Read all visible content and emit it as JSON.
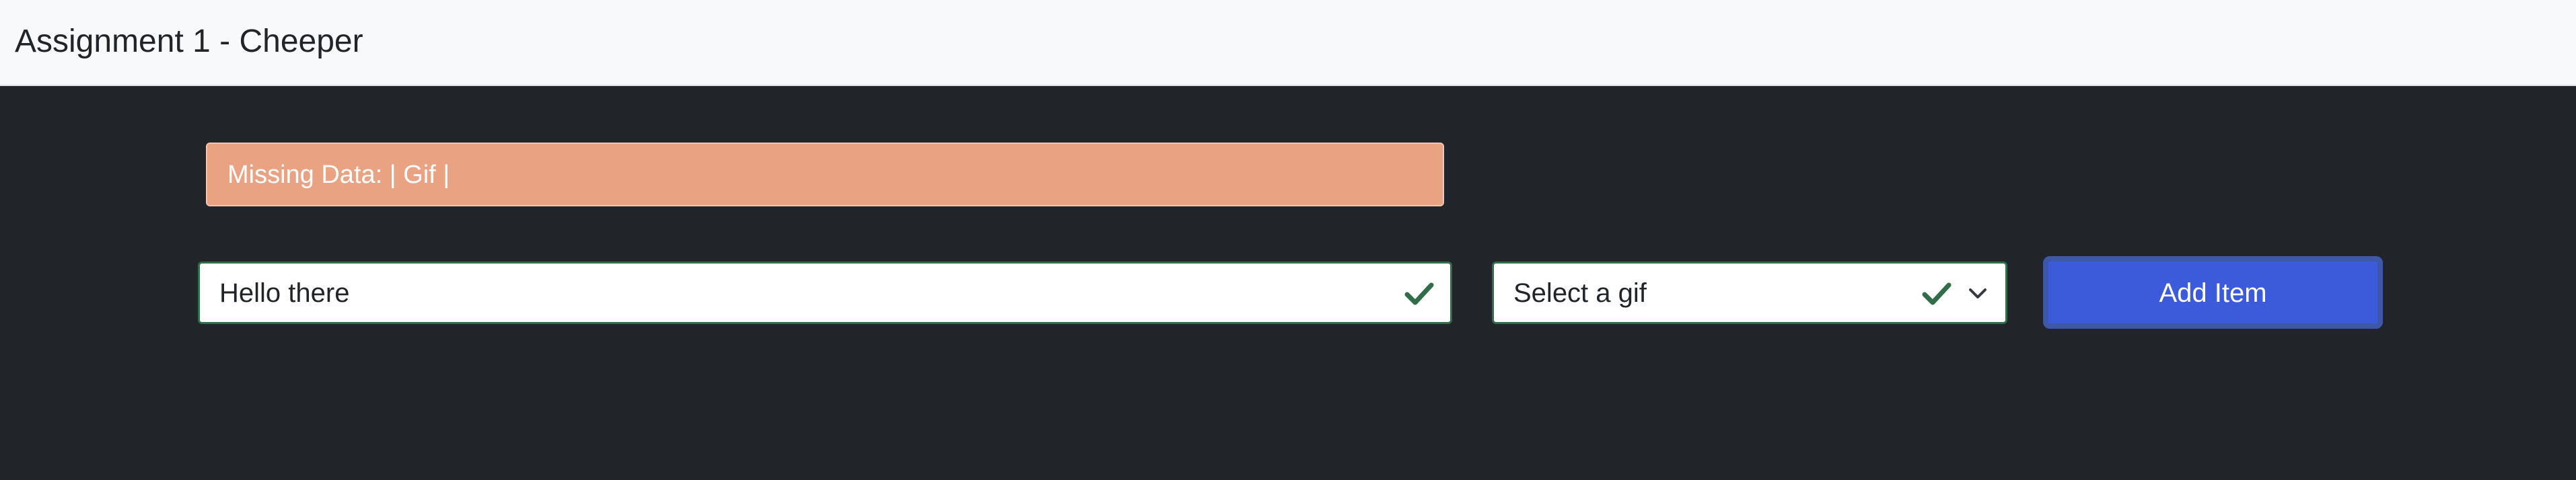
{
  "app": {
    "title": "Assignment 1 - Cheeper"
  },
  "alert": {
    "text": "Missing Data: | Gif |",
    "color": "#e9a382"
  },
  "form": {
    "message_value": "Hello there",
    "gif_selected": "Select a gif",
    "add_label": "Add Item",
    "valid_color": "#316d48",
    "button_color": "#3b5bdb"
  },
  "icons": {
    "message_valid": "check-icon",
    "gif_valid": "check-icon",
    "dropdown": "chevron-down-icon"
  }
}
